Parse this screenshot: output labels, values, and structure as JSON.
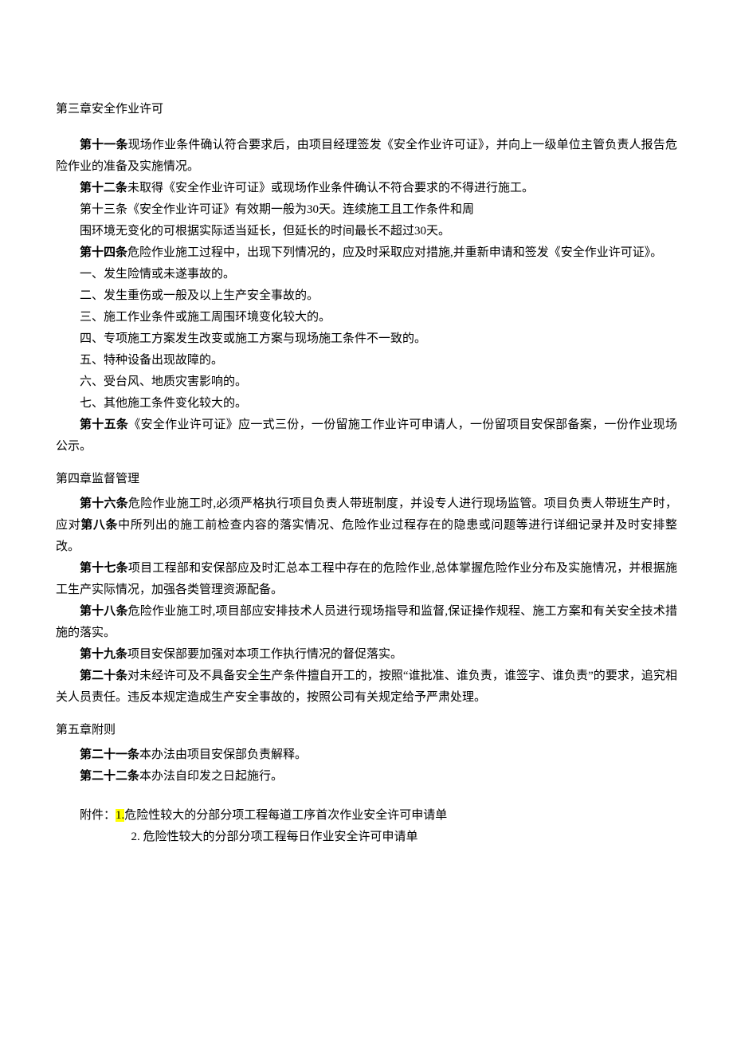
{
  "chapter3": {
    "title": "第三章安全作业许可",
    "a11": {
      "label": "第十一条",
      "text": "现场作业条件确认符合要求后，由项目经理签发《安全作业许可证》，并向上一级单位主管负责人报告危险作业的准备及实施情况。"
    },
    "a12": {
      "label": "第十二条",
      "text": "未取得《安全作业许可证》或现场作业条件确认不符合要求的不得进行施工。"
    },
    "a13": {
      "line1": "第十三条《安全作业许可证》有效期一般为30天。连续施工且工作条件和周",
      "line2": "围环境无变化的可根据实际适当延长，但延长的时间最长不超过30天。"
    },
    "a14": {
      "label": "第十四条",
      "text": "危险作业施工过程中，出现下列情况的，应及时采取应对措施,并重新申请和签发《安全作业许可证》。",
      "items": [
        "一、发生险情或未遂事故的。",
        "二、发生重伤或一般及以上生产安全事故的。",
        "三、施工作业条件或施工周围环境变化较大的。",
        "四、专项施工方案发生改变或施工方案与现场施工条件不一致的。",
        "五、特种设备出现故障的。",
        "六、受台风、地质灾害影响的。",
        "七、其他施工条件变化较大的。"
      ]
    },
    "a15": {
      "label": "第十五条",
      "text": "《安全作业许可证》应一式三份，一份留施工作业许可申请人，一份留项目安保部备案，一份作业现场公示。"
    }
  },
  "chapter4": {
    "title": "第四章监督管理",
    "a16": {
      "label": "第十六条",
      "pre": "危险作业施工时,必须严格执行项目负责人带班制度，并设专人进行现场监管。项目负责人带班生产时，应对",
      "mid_bold": "第八条",
      "post": "中所列出的施工前检查内容的落实情况、危险作业过程存在的隐患或问题等进行详细记录并及时安排整改。"
    },
    "a17": {
      "label": "第十七条",
      "text": "项目工程部和安保部应及时汇总本工程中存在的危险作业,总体掌握危险作业分布及实施情况，并根据施工生产实际情况，加强各类管理资源配备。"
    },
    "a18": {
      "label": "第十八条",
      "text": "危险作业施工时,项目部应安排技术人员进行现场指导和监督,保证操作规程、施工方案和有关安全技术措施的落实。"
    },
    "a19": {
      "label": "第十九条",
      "text": "项目安保部要加强对本项工作执行情况的督促落实。"
    },
    "a20": {
      "label": "第二十条",
      "text": "对未经许可及不具备安全生产条件擅自开工的，按照“谁批准、谁负责，谁签字、谁负责”的要求，追究相关人员责任。违反本规定造成生产安全事故的，按照公司有关规定给予严肃处理。"
    }
  },
  "chapter5": {
    "title": "第五章附则",
    "a21": {
      "label": "第二十一条",
      "text": "本办法由项目安保部负责解释。"
    },
    "a22": {
      "label": "第二十二条",
      "text": "本办法自印发之日起施行。"
    }
  },
  "attachments": {
    "prefix": "附件：",
    "num1": "1.",
    "item1": "危险性较大的分部分项工程每道工序首次作业安全许可申请单",
    "item2": "2. 危险性较大的分部分项工程每日作业安全许可申请单"
  }
}
